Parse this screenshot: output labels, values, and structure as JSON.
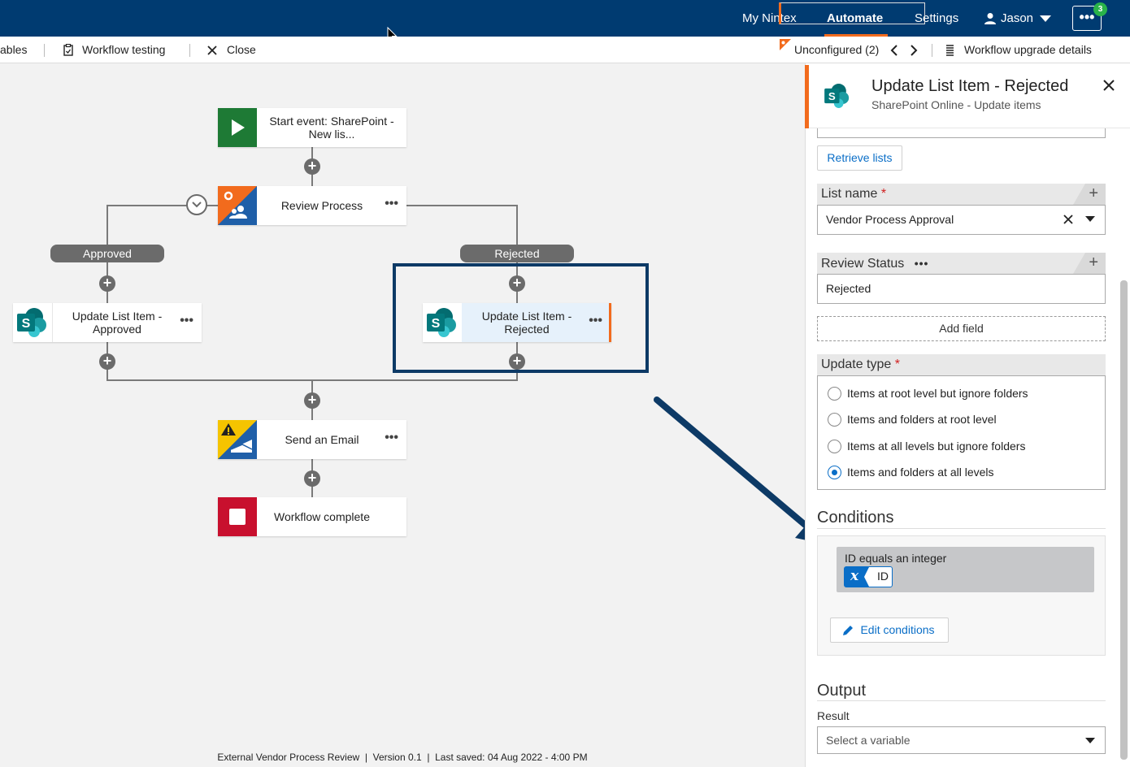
{
  "topnav": {
    "my_nintex": "My Nintex",
    "automate": "Automate",
    "settings": "Settings",
    "user": "Jason",
    "more": "•••",
    "badge": "3",
    "accent_color": "#f26b1d",
    "bg_color": "#003b71"
  },
  "toolbar": {
    "variables": "ables",
    "workflow_testing": "Workflow testing",
    "close": "Close",
    "unconfigured": "Unconfigured (2)",
    "upgrade_details": "Workflow upgrade details"
  },
  "canvas": {
    "start_event": "Start event: SharePoint - New lis...",
    "review_process": "Review Process",
    "branch_approved": "Approved",
    "branch_rejected": "Rejected",
    "update_approved": "Update List Item - Approved",
    "update_rejected": "Update List Item - Rejected",
    "send_email": "Send an Email",
    "workflow_complete": "Workflow complete",
    "node_menu": "•••"
  },
  "footer": {
    "workflow_name": "External Vendor Process Review",
    "version": "Version 0.1",
    "last_saved": "Last saved: 04 Aug 2022 - 4:00 PM"
  },
  "panel": {
    "title": "Update List Item - Rejected",
    "subtitle": "SharePoint Online - Update items",
    "retrieve_lists": "Retrieve lists",
    "list_name_label": "List name",
    "list_name_value": "Vendor Process Approval",
    "review_status_label": "Review Status",
    "review_status_value": "Rejected",
    "add_field": "Add field",
    "update_type_label": "Update type",
    "update_type_options": [
      "Items at root level but ignore folders",
      "Items and folders at root level",
      "Items at all levels but ignore folders",
      "Items and folders at all levels"
    ],
    "update_type_selected": "Items and folders at all levels",
    "conditions_title": "Conditions",
    "condition_text": "ID equals an integer",
    "condition_var": "ID",
    "edit_conditions": "Edit conditions",
    "output_title": "Output",
    "result_label": "Result",
    "result_placeholder": "Select a variable"
  }
}
